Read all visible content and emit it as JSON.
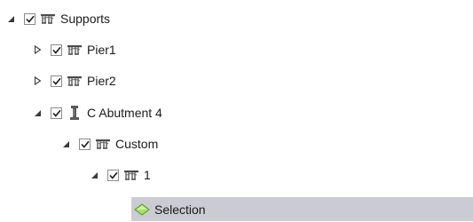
{
  "tree": {
    "nodes": [
      {
        "label": "Supports",
        "expander": "expanded",
        "checked": true,
        "icon": "support-structure-icon"
      },
      {
        "label": "Pier1",
        "expander": "collapsed",
        "checked": true,
        "icon": "support-structure-icon"
      },
      {
        "label": "Pier2",
        "expander": "collapsed",
        "checked": true,
        "icon": "support-structure-icon"
      },
      {
        "label": "C Abutment 4",
        "expander": "expanded",
        "checked": true,
        "icon": "abutment-icon"
      },
      {
        "label": "Custom",
        "expander": "expanded",
        "checked": true,
        "icon": "support-structure-icon"
      },
      {
        "label": "1",
        "expander": "expanded",
        "checked": true,
        "icon": "support-structure-icon"
      },
      {
        "label": "Selection",
        "expander": "none",
        "checked": null,
        "icon": "selection-diamond-icon",
        "selected": true
      }
    ]
  },
  "colors": {
    "selection_bg": "#cbcbd4",
    "icon_dark": "#4a4a4a",
    "check_mark": "#1a1a1a",
    "diamond_fill": "#a8e06a",
    "diamond_stroke": "#4f9a2a"
  }
}
